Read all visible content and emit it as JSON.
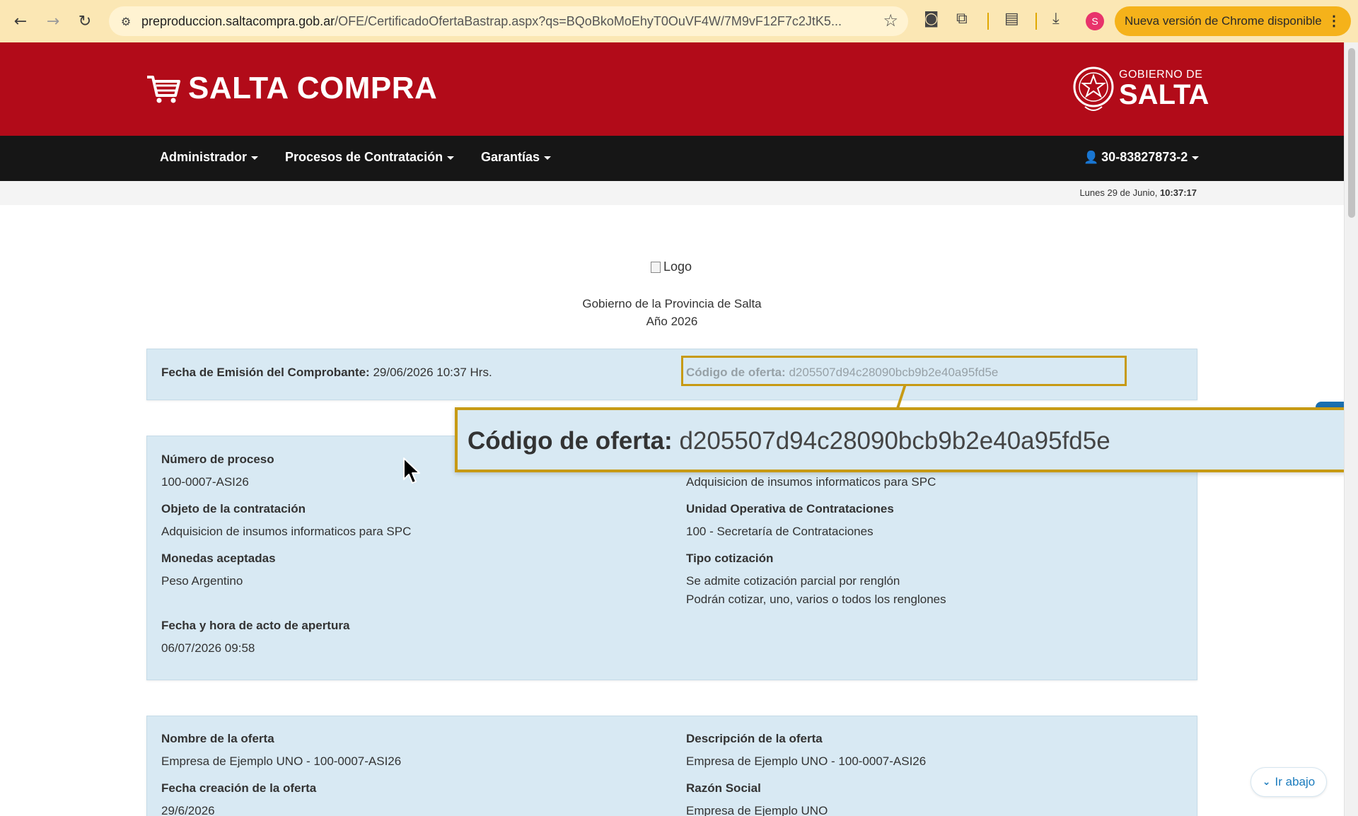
{
  "browser": {
    "url_host": "preproduccion.saltacompra.gob.ar",
    "url_path": "/OFE/CertificadoOfertaBastrap.aspx?qs=BQoBkoMoEhyT0OuVF4W/7M9vF12F7c2JtK5...",
    "update_label": "Nueva versión de Chrome disponible",
    "profile_initial": "S",
    "icons": [
      "back-arrow",
      "forward-arrow",
      "reload",
      "site-info",
      "star",
      "camera",
      "extensions",
      "reading-mode",
      "download",
      "more-vert"
    ]
  },
  "header": {
    "brand": "SALTA COMPRA",
    "gov_small": "GOBIERNO DE",
    "gov_big": "SALTA",
    "brand_color": "#b20b19"
  },
  "nav": {
    "items": [
      "Administrador",
      "Procesos de Contratación",
      "Garantías"
    ],
    "user": "30-83827873-2"
  },
  "datebar": {
    "date": "Lunes 29 de Junio,",
    "time": "10:37:17"
  },
  "doc": {
    "logo_alt": "Logo",
    "gov_line1": "Gobierno de la Provincia de Salta",
    "gov_line2": "Año 2026",
    "emision_label": "Fecha de Emisión del Comprobante:",
    "emision_value": "29/06/2026 10:37 Hrs.",
    "codigo_label": "Código de oferta:",
    "codigo_value": "d205507d94c28090bcb9b2e40a95fd5e",
    "proceso": {
      "numero_label": "Número de proceso",
      "numero_value": "100-0007-ASI26",
      "right_top_value": "Adquisicion de insumos informaticos para SPC",
      "objeto_label": "Objeto de la contratación",
      "objeto_value": "Adquisicion de insumos informaticos para SPC",
      "unidad_label": "Unidad Operativa de Contrataciones",
      "unidad_value": "100 - Secretaría de Contrataciones",
      "monedas_label": "Monedas aceptadas",
      "monedas_value": "Peso Argentino",
      "tipo_label": "Tipo cotización",
      "tipo_value1": "Se admite cotización parcial por renglón",
      "tipo_value2": "Podrán cotizar, uno, varios o todos los renglones",
      "apertura_label": "Fecha y hora de acto de apertura",
      "apertura_value": "06/07/2026 09:58"
    },
    "oferta": {
      "nombre_label": "Nombre de la oferta",
      "nombre_value": "Empresa de Ejemplo UNO - 100-0007-ASI26",
      "descripcion_label": "Descripción de la oferta",
      "descripcion_value": "Empresa de Ejemplo UNO - 100-0007-ASI26",
      "fecha_creacion_label": "Fecha creación de la oferta",
      "fecha_creacion_value": "29/6/2026",
      "razon_label": "Razón Social",
      "razon_value": "Empresa de Ejemplo UNO"
    }
  },
  "ir_abajo": "Ir abajo"
}
